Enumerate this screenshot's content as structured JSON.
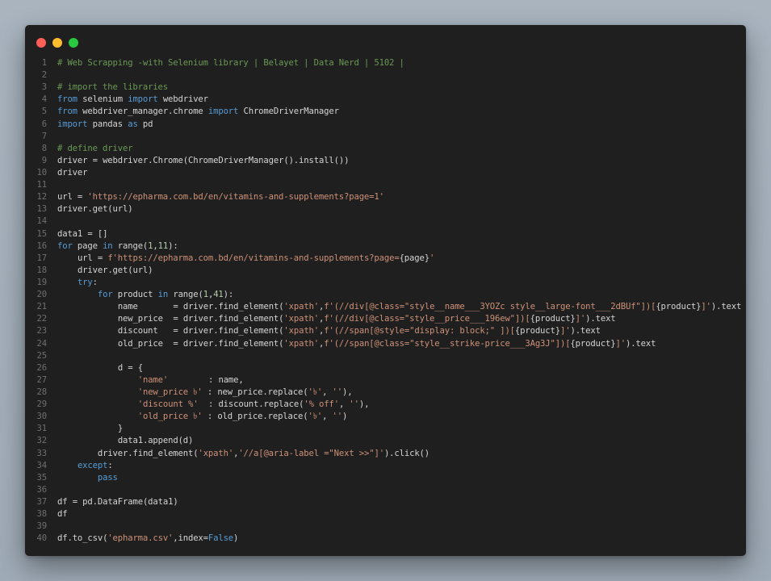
{
  "window": {
    "buttons": [
      {
        "name": "close",
        "color": "#ff5f57"
      },
      {
        "name": "minimize",
        "color": "#febc2e"
      },
      {
        "name": "maximize",
        "color": "#28c840"
      }
    ]
  },
  "theme": {
    "background": "#1f1f1f",
    "text": "#d4d4d4",
    "line_number": "#6f6f6f",
    "comment": "#6a9955",
    "keyword": "#569cd6",
    "string": "#ce9178",
    "number": "#b5cea8"
  },
  "code": {
    "lines": [
      {
        "n": "1",
        "text": "# Web Scrapping -with Selenium library | Belayet | Data Nerd | 5102 |"
      },
      {
        "n": "2",
        "text": ""
      },
      {
        "n": "3",
        "text": "# import the libraries"
      },
      {
        "n": "4",
        "text": "from selenium import webdriver"
      },
      {
        "n": "5",
        "text": "from webdriver_manager.chrome import ChromeDriverManager"
      },
      {
        "n": "6",
        "text": "import pandas as pd"
      },
      {
        "n": "7",
        "text": ""
      },
      {
        "n": "8",
        "text": "# define driver"
      },
      {
        "n": "9",
        "text": "driver = webdriver.Chrome(ChromeDriverManager().install())"
      },
      {
        "n": "10",
        "text": "driver"
      },
      {
        "n": "11",
        "text": ""
      },
      {
        "n": "12",
        "text": "url = 'https://epharma.com.bd/en/vitamins-and-supplements?page=1'"
      },
      {
        "n": "13",
        "text": "driver.get(url)"
      },
      {
        "n": "14",
        "text": ""
      },
      {
        "n": "15",
        "text": "data1 = []"
      },
      {
        "n": "16",
        "text": "for page in range(1,11):"
      },
      {
        "n": "17",
        "text": "    url = f'https://epharma.com.bd/en/vitamins-and-supplements?page={page}'"
      },
      {
        "n": "18",
        "text": "    driver.get(url)"
      },
      {
        "n": "19",
        "text": "    try:"
      },
      {
        "n": "20",
        "text": "        for product in range(1,41):"
      },
      {
        "n": "21",
        "text": "            name       = driver.find_element('xpath',f'(//div[@class=\"style__name___3YOZc style__large-font___2dBUf\"])[{product}]').text"
      },
      {
        "n": "22",
        "text": "            new_price  = driver.find_element('xpath',f'(//div[@class=\"style__price___196ew\"])[{product}]').text"
      },
      {
        "n": "23",
        "text": "            discount   = driver.find_element('xpath',f'(//span[@style=\"display: block;\" ])[{product}]').text"
      },
      {
        "n": "24",
        "text": "            old_price  = driver.find_element('xpath',f'(//span[@class=\"style__strike-price___3Ag3J\"])[{product}]').text"
      },
      {
        "n": "25",
        "text": ""
      },
      {
        "n": "26",
        "text": "            d = {"
      },
      {
        "n": "27",
        "text": "                'name'        : name,"
      },
      {
        "n": "28",
        "text": "                'new_price ৳' : new_price.replace('৳', ''),"
      },
      {
        "n": "29",
        "text": "                'discount %'  : discount.replace('% off', ''),"
      },
      {
        "n": "30",
        "text": "                'old_price ৳' : old_price.replace('৳', '')"
      },
      {
        "n": "31",
        "text": "            }"
      },
      {
        "n": "32",
        "text": "            data1.append(d)"
      },
      {
        "n": "33",
        "text": "        driver.find_element('xpath','//a[@aria-label =\"Next >>\"]').click()"
      },
      {
        "n": "34",
        "text": "    except:"
      },
      {
        "n": "35",
        "text": "        pass"
      },
      {
        "n": "36",
        "text": ""
      },
      {
        "n": "37",
        "text": "df = pd.DataFrame(data1)"
      },
      {
        "n": "38",
        "text": "df"
      },
      {
        "n": "39",
        "text": ""
      },
      {
        "n": "40",
        "text": "df.to_csv('epharma.csv',index=False)"
      }
    ]
  }
}
